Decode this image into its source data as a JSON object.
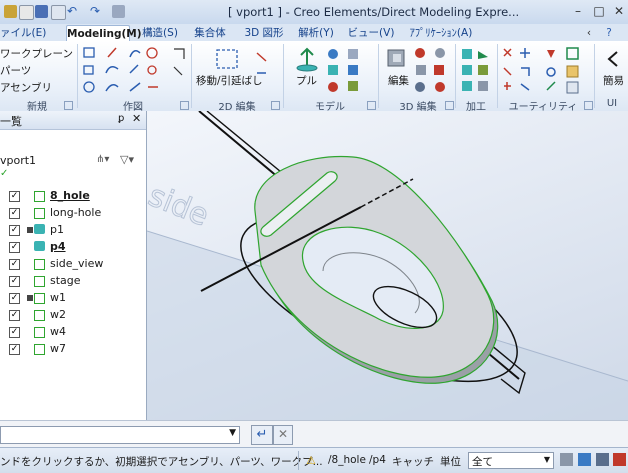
{
  "window": {
    "title": "[ vport1 ] - Creo Elements/Direct Modeling Expre...",
    "controls": [
      "–",
      "□",
      "✕"
    ]
  },
  "tabs": [
    {
      "label": "ァイル(E)"
    },
    {
      "label": "Modeling(M)"
    },
    {
      "label": "構造(S)"
    },
    {
      "label": "集合体"
    },
    {
      "label": "3D 図形"
    },
    {
      "label": "解析(Y)"
    },
    {
      "label": "ビュー(V)"
    },
    {
      "label": "ｱﾌﾟﾘｹｰｼｮﾝ(A)"
    }
  ],
  "ribbon": {
    "new_items": [
      "ワークプレーン",
      "パーツ",
      "アセンブリ"
    ],
    "groups": [
      "新規",
      "作図",
      "2D 編集",
      "モデル",
      "3D 編集",
      "加工",
      "ユーティリティ",
      "UI"
    ],
    "move_stretch": "移動/引延ばし",
    "pull": "プル",
    "edit": "編集",
    "simple": "簡易"
  },
  "tree": {
    "header": "一覧",
    "root": "vport1",
    "items": [
      {
        "label": "8_hole",
        "checked": true,
        "bold": true,
        "underline": true
      },
      {
        "label": "long-hole",
        "checked": true,
        "bold": false
      },
      {
        "label": "p1",
        "checked": true,
        "bold": false
      },
      {
        "label": "p4",
        "checked": true,
        "bold": true,
        "underline": true
      },
      {
        "label": "side_view",
        "checked": true,
        "bold": false
      },
      {
        "label": "stage",
        "checked": true,
        "bold": false
      },
      {
        "label": "w1",
        "checked": true,
        "bold": false
      },
      {
        "label": "w2",
        "checked": true,
        "bold": false
      },
      {
        "label": "w4",
        "checked": true,
        "bold": false
      },
      {
        "label": "w7",
        "checked": true,
        "bold": false
      }
    ]
  },
  "viewport": {
    "workplane_label": "side"
  },
  "statusbar": {
    "prompt": "ンドをクリックするか、初期選択でアセンブリ、パーツ、ワークプ...",
    "item1": "/8_hole",
    "item2": "/p4",
    "catch": "キャッチ",
    "unit": "単位",
    "filter": "全て"
  },
  "colors": {
    "accent": "#15428b",
    "tree_box": "#2fa52f",
    "part_teal": "#3ab3b3"
  }
}
